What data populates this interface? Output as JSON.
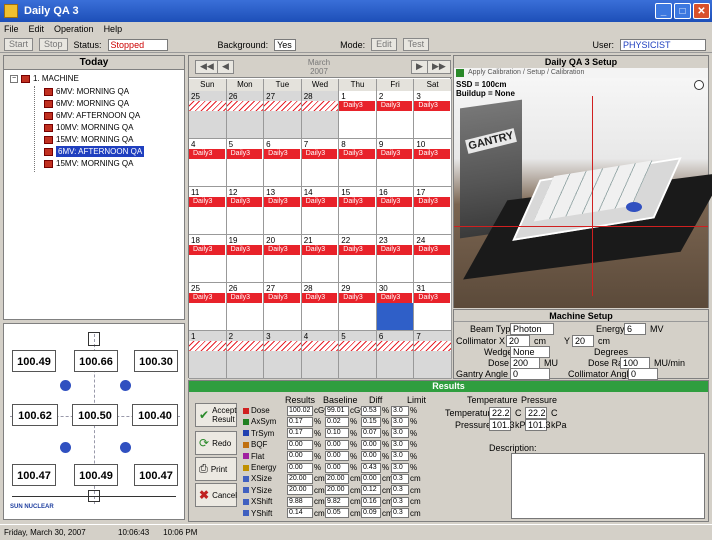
{
  "window": {
    "title": "Daily QA 3"
  },
  "menu": [
    "File",
    "Edit",
    "Operation",
    "Help"
  ],
  "toolbar": {
    "btn1": "Start",
    "btn2": "Stop",
    "status_label": "Status:",
    "status_value": "Stopped",
    "background_label": "Background:",
    "background_value": "Yes",
    "mode_label": "Mode:",
    "mode1": "Edit",
    "mode2": "Test",
    "user_label": "User:",
    "user_value": "PHYSICIST"
  },
  "today_panel": {
    "title": "Today",
    "root": "1. MACHINE",
    "items": [
      "6MV: MORNING QA",
      "6MV: MORNING QA",
      "6MV: AFTERNOON QA",
      "10MV: MORNING QA",
      "15MV: MORNING QA",
      "6MV: AFTERNOON QA",
      "15MV: MORNING QA"
    ],
    "selected_index": 5
  },
  "field_map": {
    "top": [
      "100.49",
      "100.66",
      "100.30"
    ],
    "mid": [
      "100.62",
      "100.50",
      "100.40"
    ],
    "bottom": [
      "100.47",
      "100.49",
      "100.47"
    ],
    "logo": "SUN NUCLEAR"
  },
  "calendar": {
    "month": "March",
    "year": "2007",
    "days": [
      "Sun",
      "Mon",
      "Tue",
      "Wed",
      "Thu",
      "Fri",
      "Sat"
    ],
    "rows": [
      [
        "25",
        "26",
        "27",
        "28",
        "1",
        "2",
        "3"
      ],
      [
        "4",
        "5",
        "6",
        "7",
        "8",
        "9",
        "10"
      ],
      [
        "11",
        "12",
        "13",
        "14",
        "15",
        "16",
        "17"
      ],
      [
        "18",
        "19",
        "20",
        "21",
        "22",
        "23",
        "24"
      ],
      [
        "25",
        "26",
        "27",
        "28",
        "29",
        "30",
        "31"
      ],
      [
        "1",
        "2",
        "3",
        "4",
        "5",
        "6",
        "7"
      ]
    ],
    "event": "Daily3"
  },
  "setup": {
    "title": "Daily QA 3 Setup",
    "subtitle": "Apply Calibration / Setup / Calibration",
    "ssd": "SSD = 100cm",
    "buildup": "Buildup = None",
    "gantry_text": "GANTRY"
  },
  "machine": {
    "title": "Machine Setup",
    "beam_type_label": "Beam Type",
    "beam_type": "Photon",
    "energy_label": "Energy",
    "energy": "6",
    "energy_unit": "MV",
    "collimator_label": "Collimator X",
    "collimator_x": "20",
    "collimator_x_unit": "cm",
    "collimator_y_label": "Y",
    "collimator_y": "20",
    "collimator_y_unit": "cm",
    "wedge_label": "Wedge",
    "wedge": "None",
    "wedge_unit": "Degrees",
    "dose_label": "Dose",
    "dose": "200",
    "dose_unit": "MU",
    "dose_rate_label": "Dose Rate",
    "dose_rate": "100",
    "dose_rate_unit": "MU/min",
    "gantry_angle_label": "Gantry Angle",
    "gantry_angle": "0",
    "coll_angle_label": "Collimator Angle",
    "coll_angle": "0"
  },
  "results": {
    "title": "Results",
    "col_headers": [
      "Results",
      "Baseline",
      "Diff",
      "Limit"
    ],
    "env_header_temp": "Temperature",
    "env_header_press": "Pressure",
    "rows": [
      {
        "label": "Dose",
        "c": "#d02020",
        "v": "100.02",
        "u": "cGy",
        "b": "99.01",
        "bu": "cGy",
        "d": "0.53",
        "du": "%",
        "l": "3.0",
        "lu": "%"
      },
      {
        "label": "AxSym",
        "c": "#208020",
        "v": "0.17",
        "u": "%",
        "b": "0.02",
        "bu": "%",
        "d": "0.15",
        "du": "%",
        "l": "3.0",
        "lu": "%"
      },
      {
        "label": "TrSym",
        "c": "#2040b0",
        "v": "0.17",
        "u": "%",
        "b": "0.10",
        "bu": "%",
        "d": "0.07",
        "du": "%",
        "l": "3.0",
        "lu": "%"
      },
      {
        "label": "BQF",
        "c": "#c07010",
        "v": "0.00",
        "u": "%",
        "b": "0.00",
        "bu": "%",
        "d": "0.00",
        "du": "%",
        "l": "3.0",
        "lu": "%"
      },
      {
        "label": "Flat",
        "c": "#a020a0",
        "v": "0.00",
        "u": "%",
        "b": "0.00",
        "bu": "%",
        "d": "0.00",
        "du": "%",
        "l": "3.0",
        "lu": "%"
      },
      {
        "label": "Energy",
        "c": "#c09000",
        "v": "0.00",
        "u": "%",
        "b": "0.00",
        "bu": "%",
        "d": "0.43",
        "du": "%",
        "l": "3.0",
        "lu": "%"
      },
      {
        "label": "XSize",
        "c": "#4060c0",
        "v": "20.00",
        "u": "cm",
        "b": "20.00",
        "bu": "cm",
        "d": "0.00",
        "du": "cm",
        "l": "0.3",
        "lu": "cm"
      },
      {
        "label": "YSize",
        "c": "#4060c0",
        "v": "20.00",
        "u": "cm",
        "b": "20.00",
        "bu": "cm",
        "d": "0.12",
        "du": "cm",
        "l": "0.3",
        "lu": "cm"
      },
      {
        "label": "XShift",
        "c": "#4060c0",
        "v": "9.88",
        "u": "cm",
        "b": "9.82",
        "bu": "cm",
        "d": "0.16",
        "du": "cm",
        "l": "0.3",
        "lu": "cm"
      },
      {
        "label": "YShift",
        "c": "#4060c0",
        "v": "0.14",
        "u": "cm",
        "b": "0.05",
        "bu": "cm",
        "d": "0.09",
        "du": "cm",
        "l": "0.3",
        "lu": "cm"
      }
    ],
    "temp_label": "Temperature",
    "temp": "22.2",
    "temp_unit": "C",
    "press_label": "Pressure",
    "press": "101.3",
    "press_unit": "kPa",
    "temp2": "22.2",
    "temp2_unit": "C",
    "press2": "101.3",
    "press2_unit": "kPa",
    "comments_label": "Description:"
  },
  "actions": {
    "accept": "Accept Result",
    "redo": "Redo",
    "print": "Print",
    "cancel": "Cancel"
  },
  "status": {
    "date": "Friday, March 30, 2007",
    "clock": "10:06:43",
    "time2": "10:06 PM"
  }
}
